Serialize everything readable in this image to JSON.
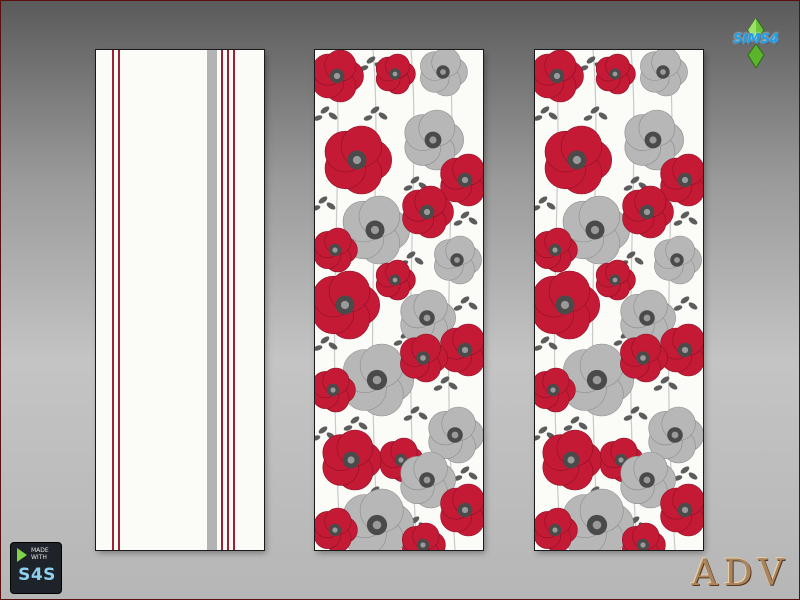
{
  "swatches": [
    {
      "name": "stripe",
      "colors": {
        "base": "#fbfbf7",
        "accent": "#9e2032",
        "secondary": "#b3b3b3"
      }
    },
    {
      "name": "poppy",
      "colors": {
        "base": "#fbfbf7",
        "flower_red": "#c41a35",
        "flower_grey": "#b7b7b7",
        "leaf": "#5c5c5c"
      }
    },
    {
      "name": "poppy",
      "colors": {
        "base": "#fbfbf7",
        "flower_red": "#c41a35",
        "flower_grey": "#b7b7b7",
        "leaf": "#5c5c5c"
      }
    }
  ],
  "badge": {
    "icon": "play-triangle-icon",
    "small_text": "MADE\nWITH",
    "big_text": "S4S"
  },
  "game_logo": {
    "text": "SIMS4",
    "icon": "plumbob-icon",
    "color": "#6cc43a"
  },
  "signature": {
    "text": "ADV"
  }
}
